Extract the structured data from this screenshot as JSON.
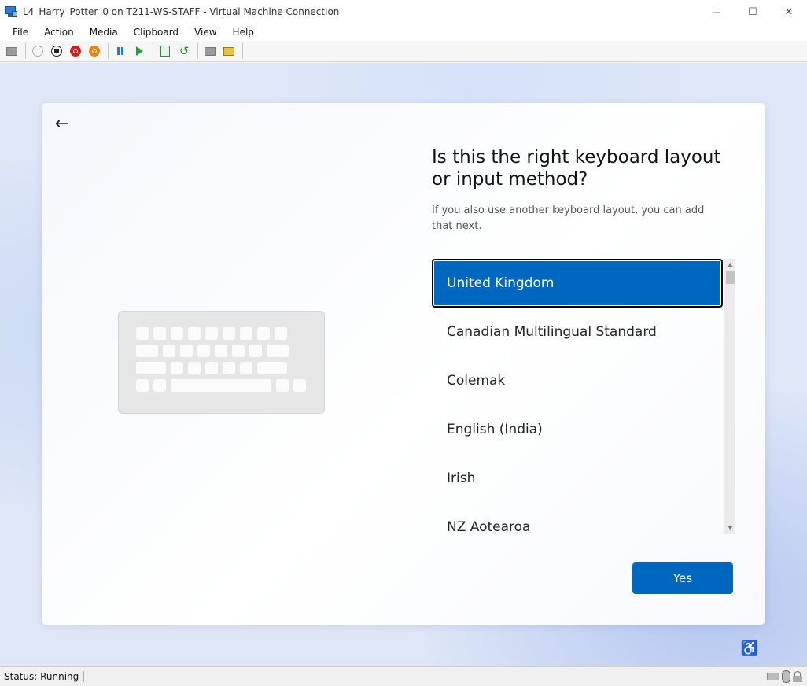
{
  "window": {
    "title": "L4_Harry_Potter_0 on T211-WS-STAFF - Virtual Machine Connection",
    "controls": {
      "minimize": "─",
      "maximize": "☐",
      "close": "✕"
    }
  },
  "menu": {
    "items": [
      "File",
      "Action",
      "Media",
      "Clipboard",
      "View",
      "Help"
    ]
  },
  "toolbar": {
    "icons": [
      "ctrl-alt-del-icon",
      "start-icon",
      "turn-off-icon",
      "shutdown-icon",
      "save-state-icon",
      "pause-icon",
      "resume-icon",
      "checkpoint-icon",
      "revert-icon",
      "enhanced-session-icon",
      "share-icon"
    ]
  },
  "setup": {
    "back_glyph": "←",
    "heading": "Is this the right keyboard layout or input method?",
    "subtext": "If you also use another keyboard layout, you can add that next.",
    "layouts": [
      "United Kingdom",
      "Canadian Multilingual Standard",
      "Colemak",
      "English (India)",
      "Irish",
      "NZ Aotearoa"
    ],
    "selected": "United Kingdom",
    "yes_label": "Yes",
    "scroll_up": "▲",
    "scroll_down": "▼",
    "accessibility_glyph": "♿"
  },
  "status": {
    "text": "Status: Running"
  },
  "colors": {
    "accent": "#0067c0",
    "background": "#dfe7f7"
  }
}
